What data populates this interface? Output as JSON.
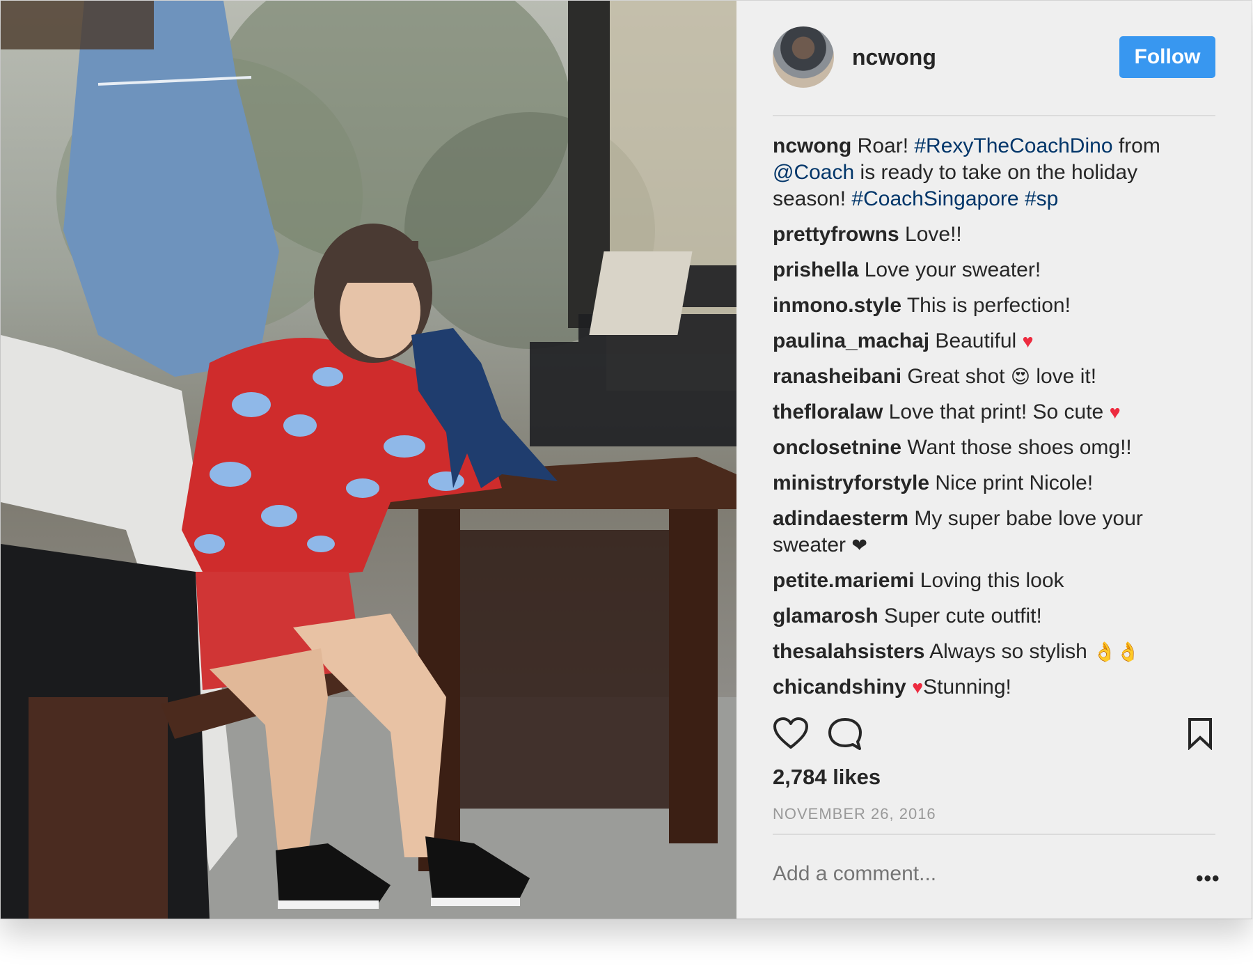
{
  "post": {
    "username": "ncwong",
    "follow_label": "Follow",
    "likes": "2,784 likes",
    "date": "NOVEMBER 26, 2016",
    "add_comment_placeholder": "Add a comment...",
    "more_label": "•••"
  },
  "caption": {
    "user": "ncwong",
    "t1": " Roar! ",
    "tag1": "#RexyTheCoachDino",
    "t2": " from ",
    "mention": "@Coach",
    "t3": " is ready to take on the holiday season! ",
    "tag2": "#CoachSingapore",
    "t4": " ",
    "tag3": "#sp"
  },
  "comments": [
    {
      "user": "prettyfrowns",
      "text": " Love!!"
    },
    {
      "user": "prishella",
      "text": " Love your sweater!"
    },
    {
      "user": "inmono.style",
      "text": " This is perfection!"
    },
    {
      "user": "paulina_machaj",
      "text": " Beautiful ",
      "emoji": "♥"
    },
    {
      "user": "ranasheibani",
      "text": " Great shot ",
      "emoji": "😍",
      "tail": " love it!"
    },
    {
      "user": "thefloralaw",
      "text": " Love that print! So cute ",
      "emoji": "♥"
    },
    {
      "user": "onclosetnine",
      "text": " Want those shoes omg!!"
    },
    {
      "user": "ministryforstyle",
      "text": " Nice print Nicole!"
    },
    {
      "user": "adindaesterm",
      "text": " My super babe love your sweater ",
      "emoji": "❤"
    },
    {
      "user": "petite.mariemi",
      "text": " Loving this look"
    },
    {
      "user": "glamarosh",
      "text": " Super cute outfit!"
    },
    {
      "user": "thesalahsisters",
      "text": " Always so stylish ",
      "emoji": "👌👌"
    },
    {
      "user": "chicandshiny",
      "text": " ",
      "emoji": "♥",
      "tail": "Stunning!"
    }
  ],
  "icons": {
    "like": "heart-outline-icon",
    "comment": "speech-bubble-icon",
    "save": "bookmark-icon"
  },
  "colors": {
    "follow_button": "#3897f0",
    "hashtag": "#003569",
    "heart": "#ed2b3f",
    "panel_bg": "#efefef"
  }
}
